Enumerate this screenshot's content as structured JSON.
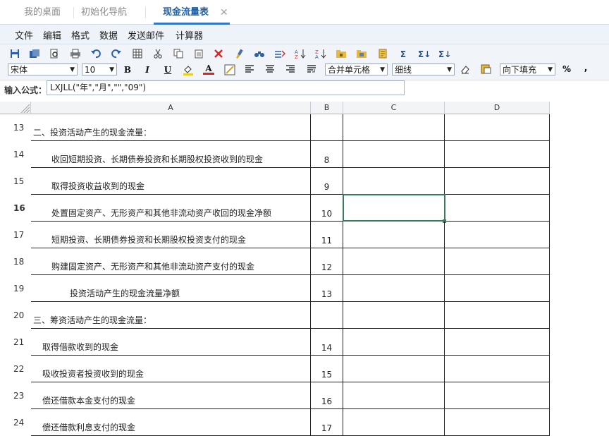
{
  "tabs": [
    {
      "label": "我的桌面"
    },
    {
      "label": "初始化导航"
    },
    {
      "label": "现金流量表",
      "active": true
    }
  ],
  "tab_close_glyph": "✕",
  "menu": [
    "文件",
    "编辑",
    "格式",
    "数据",
    "发送邮件",
    "计算器"
  ],
  "toolbar": {
    "font": "宋体",
    "size": "10",
    "bold": "B",
    "italic": "I",
    "underline": "U",
    "font_color": "A",
    "merge": "合并单元格",
    "border": "细线",
    "fill": "向下填充",
    "percent": "%",
    "comma": ","
  },
  "formula": {
    "label": "输入公式：",
    "value": "LXJLL(\"年\",\"月\",\"\",\"09\")"
  },
  "columns": [
    "A",
    "B",
    "C",
    "D"
  ],
  "rows": [
    {
      "num": "13",
      "a": "二、投资活动产生的现金流量：",
      "b": "",
      "indent": 0
    },
    {
      "num": "14",
      "a": "收回短期投资、长期债券投资和长期股权投资收到的现金",
      "b": "8",
      "indent": 2
    },
    {
      "num": "15",
      "a": "取得投资收益收到的现金",
      "b": "9",
      "indent": 2
    },
    {
      "num": "16",
      "a": "处置固定资产、无形资产和其他非流动资产收回的现金净额",
      "b": "10",
      "indent": 2,
      "selected": true
    },
    {
      "num": "17",
      "a": "短期投资、长期债券投资和长期股权投资支付的现金",
      "b": "11",
      "indent": 2
    },
    {
      "num": "18",
      "a": "购建固定资产、无形资产和其他非流动资产支付的现金",
      "b": "12",
      "indent": 2
    },
    {
      "num": "19",
      "a": "投资活动产生的现金流量净额",
      "b": "13",
      "indent": 4
    },
    {
      "num": "20",
      "a": "三、筹资活动产生的现金流量：",
      "b": "",
      "indent": 0
    },
    {
      "num": "21",
      "a": "取得借款收到的现金",
      "b": "14",
      "indent": 1
    },
    {
      "num": "22",
      "a": "吸收投资者投资收到的现金",
      "b": "15",
      "indent": 1
    },
    {
      "num": "23",
      "a": "偿还借款本金支付的现金",
      "b": "16",
      "indent": 1
    },
    {
      "num": "24",
      "a": "偿还借款利息支付的现金",
      "b": "17",
      "indent": 1
    }
  ]
}
